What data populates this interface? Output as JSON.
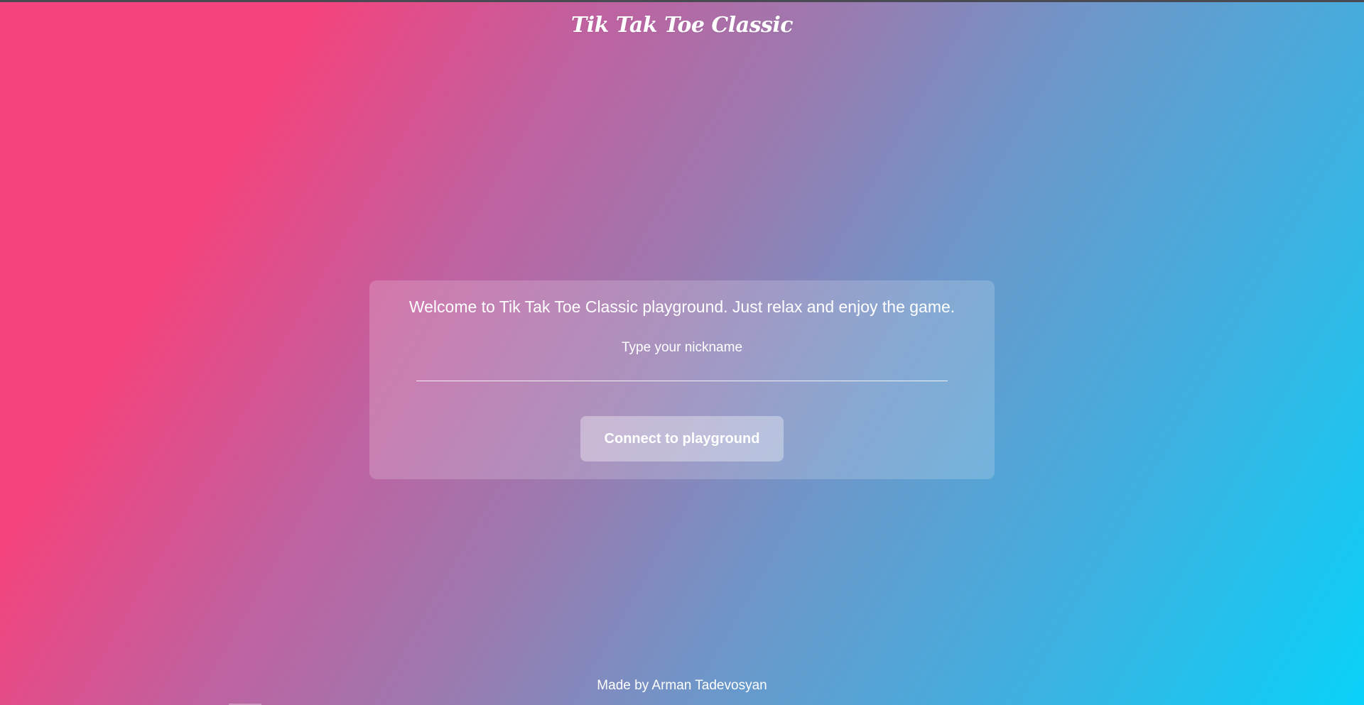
{
  "app": {
    "title": "Tik Tak Toe Classic"
  },
  "card": {
    "welcome_text": "Welcome to Tik Tak Toe Classic playground. Just relax and enjoy the game.",
    "nickname_label": "Type your nickname",
    "nickname_value": "",
    "nickname_placeholder": "",
    "connect_button_label": "Connect to playground"
  },
  "footer": {
    "credit": "Made by Arman Tadevosyan"
  },
  "colors": {
    "gradient_start": "#f4437d",
    "gradient_end": "#09d2f9",
    "text": "#ffffff"
  }
}
